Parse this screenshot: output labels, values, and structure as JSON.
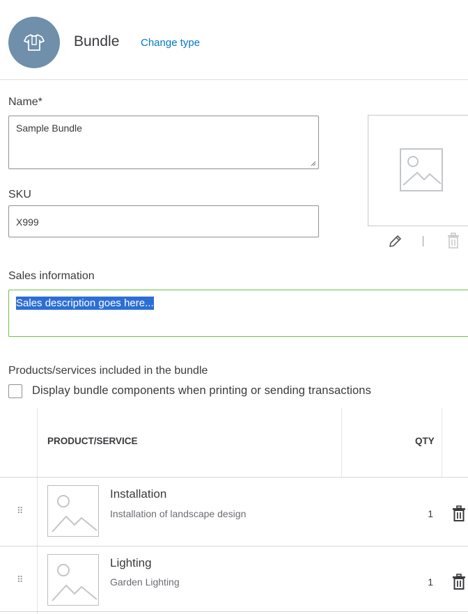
{
  "header": {
    "type_title": "Bundle",
    "change_type_label": "Change type",
    "icon": "tshirt-icon"
  },
  "form": {
    "name_label": "Name*",
    "name_value": "Sample Bundle",
    "sku_label": "SKU",
    "sku_value": "X999",
    "image": {
      "placeholder_icon": "image-placeholder-icon",
      "edit_icon": "pencil-icon",
      "delete_icon": "trash-icon"
    }
  },
  "sales": {
    "label": "Sales information",
    "description": "Sales description goes here..."
  },
  "bundle": {
    "label": "Products/services included in the bundle",
    "checkbox_label": "Display bundle components when printing or sending transactions",
    "checked": false,
    "columns": [
      "PRODUCT/SERVICE",
      "QTY"
    ],
    "rows": [
      {
        "name": "Installation",
        "description": "Installation of landscape design",
        "qty": "1"
      },
      {
        "name": "Lighting",
        "description": "Garden Lighting",
        "qty": "1"
      }
    ]
  },
  "colors": {
    "accent_link": "#0077c5",
    "icon_circle": "#6f8fab",
    "focus_border": "#6cc04a",
    "selection": "#2c6ed5"
  }
}
